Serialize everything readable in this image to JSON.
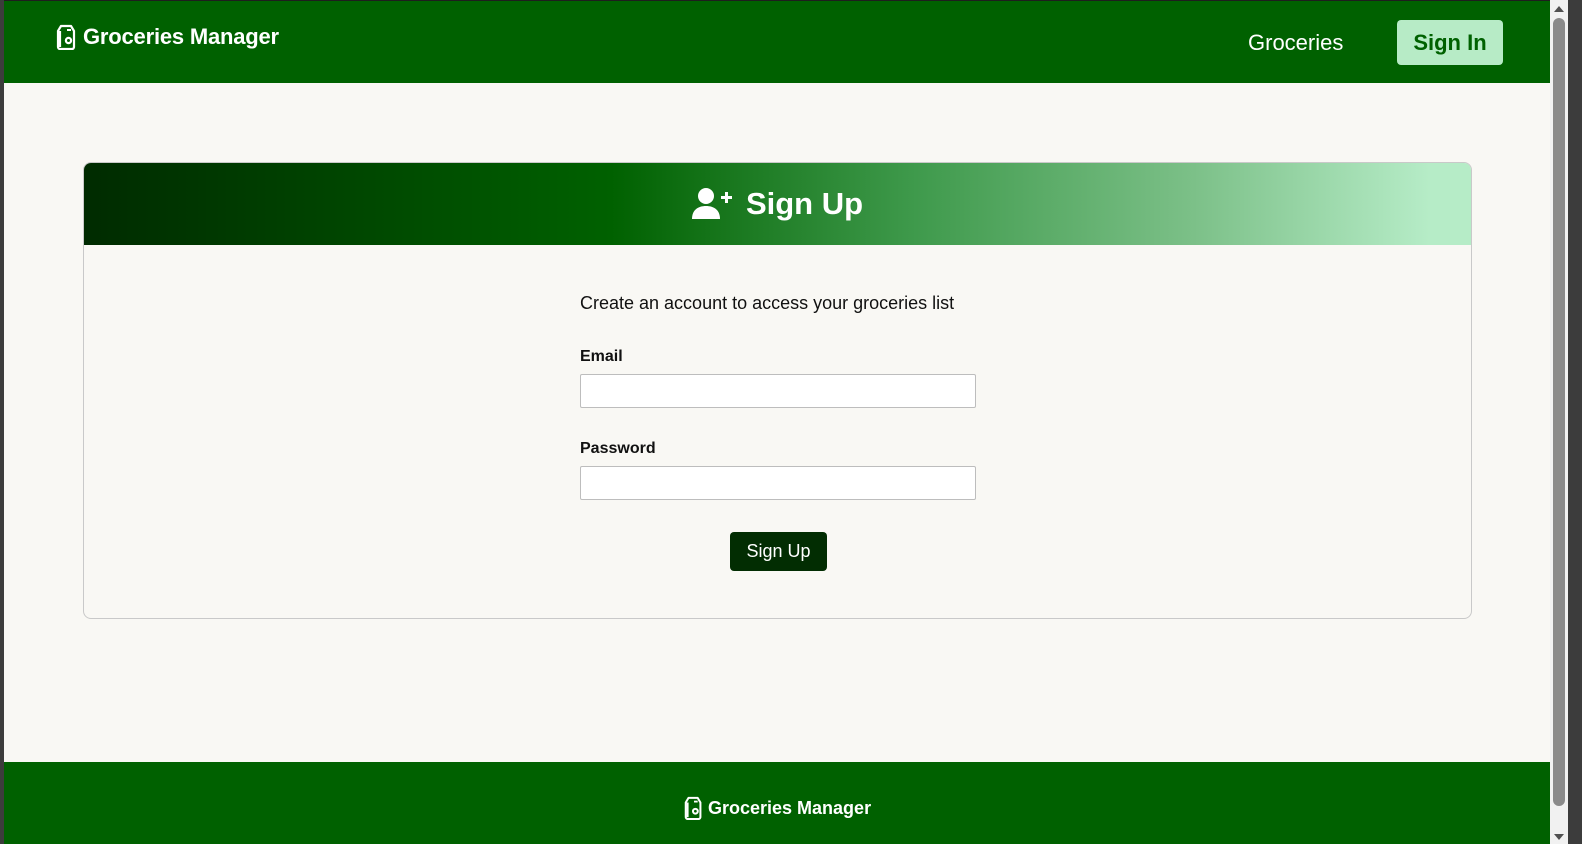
{
  "navbar": {
    "brand": "Groceries Manager",
    "brand_icon": "grocery-bag-icon",
    "links": {
      "groceries": "Groceries",
      "sign_in": "Sign In"
    }
  },
  "signup_card": {
    "header_icon": "user-plus-icon",
    "title": "Sign Up",
    "intro": "Create an account to access your groceries list",
    "email_label": "Email",
    "email_value": "",
    "password_label": "Password",
    "password_value": "",
    "submit_label": "Sign Up"
  },
  "footer": {
    "brand": "Groceries Manager",
    "brand_icon": "grocery-bag-icon"
  },
  "colors": {
    "brand_green": "#006100",
    "signin_bg": "#b7ebc6",
    "button_dark": "#022d02",
    "page_bg": "#f9f8f4"
  }
}
